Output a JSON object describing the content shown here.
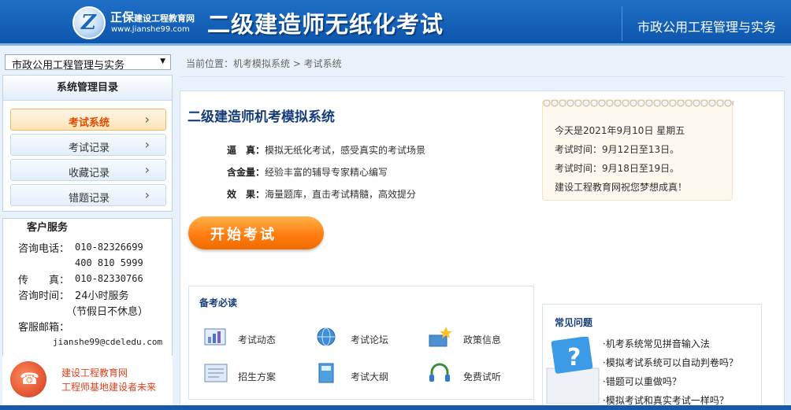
{
  "header": {
    "brand": "正保",
    "brand_small": "建设工程教育网",
    "url": "www.jianshe99.com",
    "title": "二级建造师无纸化考试",
    "subject": "市政公用工程管理与实务"
  },
  "sidebar": {
    "selected_subject": "市政公用工程管理与实务",
    "menu_title": "系统管理目录",
    "items": [
      {
        "label": "考试系统"
      },
      {
        "label": "考试记录"
      },
      {
        "label": "收藏记录"
      },
      {
        "label": "错题记录"
      }
    ]
  },
  "service": {
    "title": "客户服务",
    "phone_label": "咨询电话：",
    "phone1": "010-82326699",
    "phone2": "400 810 5999",
    "fax_label": "传　　真：",
    "fax": "010-82330766",
    "hours_label": "咨询时间：",
    "hours": "24小时服务",
    "hours_note": "（节假日不休息）",
    "email_label": "客服邮箱：",
    "email": "jianshe99@cdeledu.com",
    "promo_line1": "建设工程教育网",
    "promo_line2": "工程师基地建设者未来"
  },
  "breadcrumb": "当前位置：机考模拟系统 > 考试系统",
  "main": {
    "title": "二级建造师机考模拟系统",
    "features": [
      {
        "label": "逼　真：",
        "text": "模拟无纸化考试，感受真实的考试场景"
      },
      {
        "label": "含金量：",
        "text": "经验丰富的辅导专家精心编写"
      },
      {
        "label": "效　果：",
        "text": "海量题库，直击考试精髓，高效提分"
      }
    ],
    "start_label": "开始考试"
  },
  "notice": {
    "lines": [
      "今天是2021年9月10日  星期五",
      "考试时间：9月12日至13日。",
      "考试时间：9月18日至19日。",
      "建设工程教育网祝您梦想成真！"
    ]
  },
  "prep": {
    "title": "备考必读",
    "links": [
      {
        "label": "考试动态",
        "icon": "chart-icon"
      },
      {
        "label": "考试论坛",
        "icon": "globe-icon"
      },
      {
        "label": "政策信息",
        "icon": "star-icon"
      },
      {
        "label": "招生方案",
        "icon": "document-icon"
      },
      {
        "label": "考试大纲",
        "icon": "book-icon"
      },
      {
        "label": "免费试听",
        "icon": "headphone-icon"
      }
    ]
  },
  "faq": {
    "title": "常见问题",
    "links": [
      "·机考系统常见拼音输入法",
      "·模拟考试系统可以自动判卷吗？",
      "·错题可以重做吗？",
      "·模拟考试和真实考试一样吗？"
    ]
  },
  "colors": {
    "header_blue": "#0d56ad",
    "accent_orange": "#ff7e10",
    "title_navy": "#163d79"
  }
}
